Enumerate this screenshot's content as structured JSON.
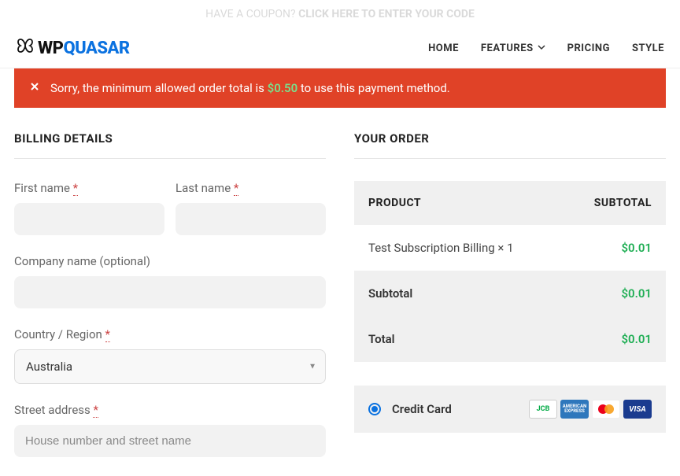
{
  "header": {
    "logo_prefix": "WP",
    "logo_suffix": "QUASAR",
    "nav": {
      "home": "HOME",
      "features": "FEATURES",
      "pricing": "PRICING",
      "style": "STYLE"
    }
  },
  "coupon": {
    "text": "HAVE A COUPON? ",
    "link": "CLICK HERE TO ENTER YOUR CODE"
  },
  "error": {
    "prefix": "Sorry, the minimum allowed order total is ",
    "amount": "$0.50",
    "suffix": " to use this payment method."
  },
  "billing": {
    "title": "BILLING DETAILS",
    "first_name_label": "First name ",
    "last_name_label": "Last name ",
    "company_label": "Company name (optional)",
    "country_label": "Country / Region ",
    "country_value": "Australia",
    "street_label": "Street address ",
    "street_placeholder": "House number and street name",
    "required_mark": "*"
  },
  "order": {
    "title": "YOUR ORDER",
    "head_product": "PRODUCT",
    "head_subtotal": "SUBTOTAL",
    "item_name": "Test Subscription Billing  × 1",
    "item_price": "$0.01",
    "subtotal_label": "Subtotal",
    "subtotal_value": "$0.01",
    "total_label": "Total",
    "total_value": "$0.01"
  },
  "payment": {
    "label": "Credit Card",
    "cards": {
      "jcb": "JCB",
      "amex": "AMERICAN EXPRESS",
      "visa": "VISA"
    }
  }
}
